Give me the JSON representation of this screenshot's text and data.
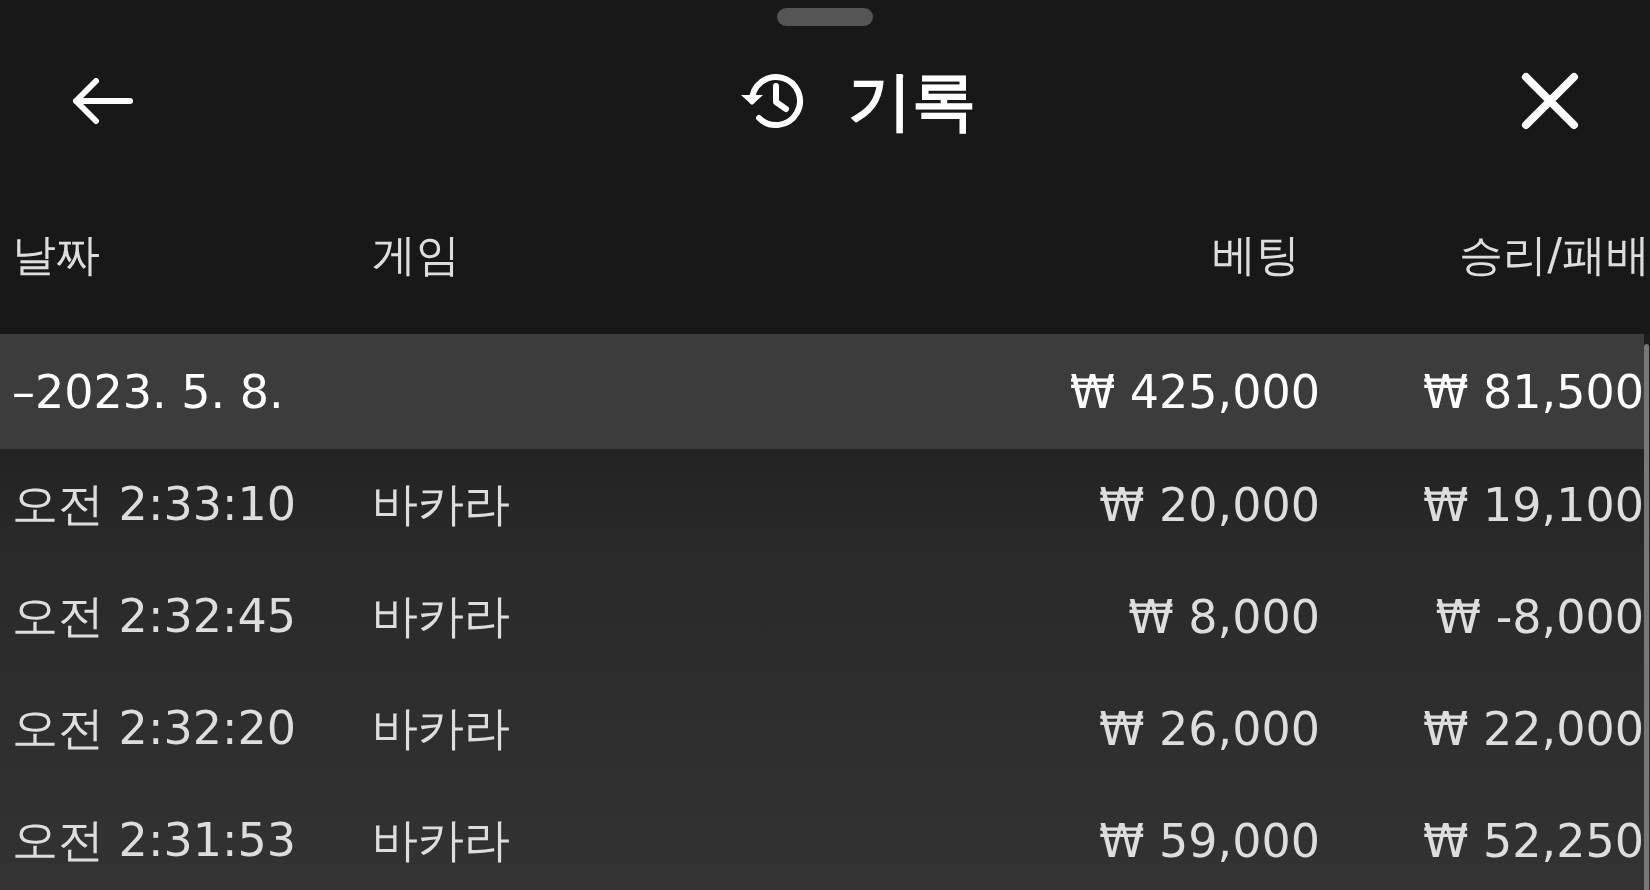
{
  "header": {
    "title": "기록"
  },
  "table": {
    "columns": [
      "날짜",
      "게임",
      "베팅",
      "승리/패배"
    ],
    "rows": [
      {
        "kind": "group",
        "date": "–2023. 5. 8.",
        "game": "",
        "bet": "₩ 425,000",
        "result": "₩ 81,500"
      },
      {
        "kind": "entry",
        "date": "오전 2:33:10",
        "game": "바카라",
        "bet": "₩ 20,000",
        "result": "₩ 19,100"
      },
      {
        "kind": "entry",
        "date": "오전 2:32:45",
        "game": "바카라",
        "bet": "₩ 8,000",
        "result": "₩ -8,000"
      },
      {
        "kind": "entry",
        "date": "오전 2:32:20",
        "game": "바카라",
        "bet": "₩ 26,000",
        "result": "₩ 22,000"
      },
      {
        "kind": "entry",
        "date": "오전 2:31:53",
        "game": "바카라",
        "bet": "₩ 59,000",
        "result": "₩ 52,250"
      }
    ]
  }
}
